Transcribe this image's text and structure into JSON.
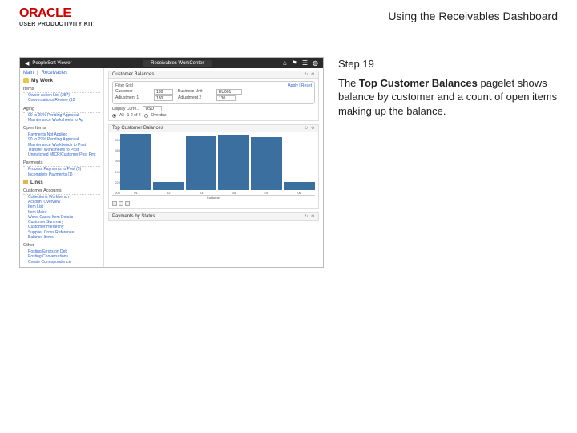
{
  "header": {
    "logo_main": "ORACLE",
    "logo_sub": "USER PRODUCTIVITY KIT",
    "doc_title": "Using the Receivables Dashboard"
  },
  "instruction": {
    "step_label": "Step 19",
    "body_pre": "The ",
    "body_bold": "Top Customer Balances",
    "body_post": " pagelet shows balance by customer and a count of open items making up the balance."
  },
  "app": {
    "back_label": "PeopleSoft Viewer",
    "center_title": "Receivables WorkCenter",
    "top_icons": {
      "home": "home-icon",
      "flag": "flag-icon",
      "menu": "menu-icon",
      "user": "user-icon"
    },
    "crumb": {
      "a": "Main",
      "b": "Receivables"
    },
    "mywork_title": "My Work",
    "sections": [
      {
        "title": "Items",
        "items": [
          "Owner Action List (287)",
          "Conversations Review (12"
        ]
      },
      {
        "title": "Aging",
        "items": [
          "90 to 29% Pending Approval",
          "Maintenance Worksheets to Ap"
        ]
      },
      {
        "title": "Open Items",
        "items": [
          "Payments Not Applied",
          "90 to 29% Pending Approval",
          "Maintenance Workbench to Post",
          "Transfer Worksheets to Post",
          "Unmatched MICR/Customer Post Pmt"
        ]
      },
      {
        "title": "Payments",
        "items": [
          "Process Payments to Post (5)",
          "Incomplete Payments (1)"
        ]
      }
    ],
    "links_title": "Links",
    "link_groups": [
      {
        "title": "Customer Accounts",
        "items": [
          "Collections Workbench",
          "Account Overview",
          "Item List",
          "Item Maint",
          "Worst Cases Item Details",
          "Customer Summary",
          "Customer Hierarchy",
          "Supplier Cross Reference",
          "Balance Items"
        ]
      },
      {
        "title": "Other",
        "items": [
          "Posting Errors on Deb",
          "Posting Conversations",
          "Create Correspondence"
        ]
      }
    ],
    "module_balances": {
      "title": "Customer Balances",
      "filter_legend": "Filter Grid",
      "filter_actions": "Apply | Reset",
      "rows": [
        {
          "label1": "Customer",
          "val1": "130",
          "label2": "Business Unit",
          "val2": "EU001"
        },
        {
          "label1": "Adjustment 1",
          "val1": "130",
          "label2": "Adjustment 2",
          "val2": "130"
        }
      ],
      "display_label": "Display Curre...",
      "display_value": "USD",
      "radio_all": "All",
      "radio_all_legend": "1-2   of 2",
      "radio_overdue": "Overdue"
    },
    "module_top": {
      "title": "Top Customer Balances"
    },
    "module_status": {
      "title": "Payments by Status"
    }
  },
  "chart_data": {
    "type": "bar",
    "title": "Top Customer Balances",
    "xlabel": "Customer",
    "ylabel": "",
    "y_ticks": [
      300,
      280,
      260,
      240,
      220,
      200
    ],
    "categories": [
      "01",
      "02",
      "03",
      "04",
      "05",
      "06"
    ],
    "values": [
      300,
      20,
      290,
      295,
      285,
      20
    ]
  }
}
